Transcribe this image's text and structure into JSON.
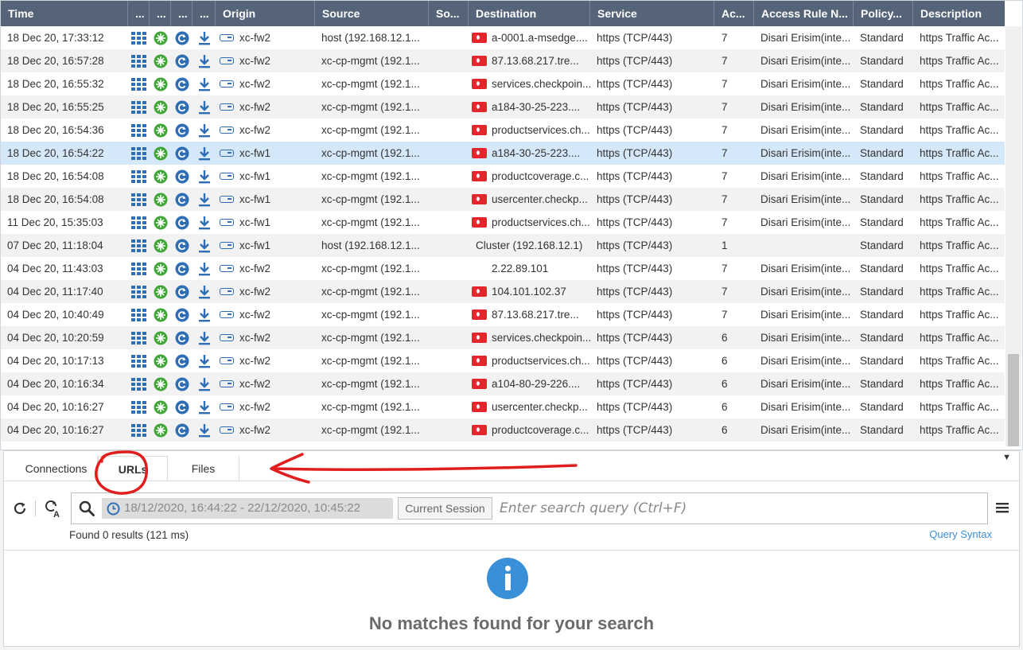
{
  "columns": [
    {
      "key": "time",
      "label": "Time"
    },
    {
      "key": "i1",
      "label": "..."
    },
    {
      "key": "i2",
      "label": "..."
    },
    {
      "key": "i3",
      "label": "..."
    },
    {
      "key": "i4",
      "label": "..."
    },
    {
      "key": "origin",
      "label": "Origin"
    },
    {
      "key": "source",
      "label": "Source"
    },
    {
      "key": "sourceuser",
      "label": "So..."
    },
    {
      "key": "destination",
      "label": "Destination"
    },
    {
      "key": "service",
      "label": "Service"
    },
    {
      "key": "action",
      "label": "Ac..."
    },
    {
      "key": "rule",
      "label": "Access Rule N..."
    },
    {
      "key": "policy",
      "label": "Policy..."
    },
    {
      "key": "description",
      "label": "Description"
    }
  ],
  "rows": [
    {
      "time": "18 Dec 20, 17:33:12",
      "origin": "xc-fw2",
      "source": "host (192.168.12.1...",
      "dest": "a-0001.a-msedge....",
      "flag": true,
      "service": "https (TCP/443)",
      "ac": "7",
      "rule": "Disari Erisim(inte...",
      "policy": "Standard",
      "desc": "https Traffic Ac...",
      "selected": false
    },
    {
      "time": "18 Dec 20, 16:57:28",
      "origin": "xc-fw2",
      "source": "xc-cp-mgmt (192.1...",
      "dest": "87.13.68.217.tre...",
      "flag": true,
      "service": "https (TCP/443)",
      "ac": "7",
      "rule": "Disari Erisim(inte...",
      "policy": "Standard",
      "desc": "https Traffic Ac...",
      "selected": false
    },
    {
      "time": "18 Dec 20, 16:55:32",
      "origin": "xc-fw2",
      "source": "xc-cp-mgmt (192.1...",
      "dest": "services.checkpoin...",
      "flag": true,
      "service": "https (TCP/443)",
      "ac": "7",
      "rule": "Disari Erisim(inte...",
      "policy": "Standard",
      "desc": "https Traffic Ac...",
      "selected": false
    },
    {
      "time": "18 Dec 20, 16:55:25",
      "origin": "xc-fw2",
      "source": "xc-cp-mgmt (192.1...",
      "dest": "a184-30-25-223....",
      "flag": true,
      "service": "https (TCP/443)",
      "ac": "7",
      "rule": "Disari Erisim(inte...",
      "policy": "Standard",
      "desc": "https Traffic Ac...",
      "selected": false
    },
    {
      "time": "18 Dec 20, 16:54:36",
      "origin": "xc-fw2",
      "source": "xc-cp-mgmt (192.1...",
      "dest": "productservices.ch...",
      "flag": true,
      "service": "https (TCP/443)",
      "ac": "7",
      "rule": "Disari Erisim(inte...",
      "policy": "Standard",
      "desc": "https Traffic Ac...",
      "selected": false
    },
    {
      "time": "18 Dec 20, 16:54:22",
      "origin": "xc-fw1",
      "source": "xc-cp-mgmt (192.1...",
      "dest": "a184-30-25-223....",
      "flag": true,
      "service": "https (TCP/443)",
      "ac": "7",
      "rule": "Disari Erisim(inte...",
      "policy": "Standard",
      "desc": "https Traffic Ac...",
      "selected": true
    },
    {
      "time": "18 Dec 20, 16:54:08",
      "origin": "xc-fw1",
      "source": "xc-cp-mgmt (192.1...",
      "dest": "productcoverage.c...",
      "flag": true,
      "service": "https (TCP/443)",
      "ac": "7",
      "rule": "Disari Erisim(inte...",
      "policy": "Standard",
      "desc": "https Traffic Ac...",
      "selected": false
    },
    {
      "time": "18 Dec 20, 16:54:08",
      "origin": "xc-fw1",
      "source": "xc-cp-mgmt (192.1...",
      "dest": "usercenter.checkp...",
      "flag": true,
      "service": "https (TCP/443)",
      "ac": "7",
      "rule": "Disari Erisim(inte...",
      "policy": "Standard",
      "desc": "https Traffic Ac...",
      "selected": false
    },
    {
      "time": "11 Dec 20, 15:35:03",
      "origin": "xc-fw1",
      "source": "xc-cp-mgmt (192.1...",
      "dest": "productservices.ch...",
      "flag": true,
      "service": "https (TCP/443)",
      "ac": "7",
      "rule": "Disari Erisim(inte...",
      "policy": "Standard",
      "desc": "https Traffic Ac...",
      "selected": false
    },
    {
      "time": "07 Dec 20, 11:18:04",
      "origin": "xc-fw1",
      "source": "host (192.168.12.1...",
      "dest": "Cluster (192.168.12.1)",
      "flag": false,
      "noindent": true,
      "service": "https (TCP/443)",
      "ac": "1",
      "rule": "",
      "policy": "Standard",
      "desc": "https Traffic Ac...",
      "selected": false
    },
    {
      "time": "04 Dec 20, 11:43:03",
      "origin": "xc-fw2",
      "source": "xc-cp-mgmt (192.1...",
      "dest": "2.22.89.101",
      "flag": false,
      "service": "https (TCP/443)",
      "ac": "7",
      "rule": "Disari Erisim(inte...",
      "policy": "Standard",
      "desc": "https Traffic Ac...",
      "selected": false
    },
    {
      "time": "04 Dec 20, 11:17:40",
      "origin": "xc-fw2",
      "source": "xc-cp-mgmt (192.1...",
      "dest": "104.101.102.37",
      "flag": true,
      "service": "https (TCP/443)",
      "ac": "7",
      "rule": "Disari Erisim(inte...",
      "policy": "Standard",
      "desc": "https Traffic Ac...",
      "selected": false
    },
    {
      "time": "04 Dec 20, 10:40:49",
      "origin": "xc-fw2",
      "source": "xc-cp-mgmt (192.1...",
      "dest": "87.13.68.217.tre...",
      "flag": true,
      "service": "https (TCP/443)",
      "ac": "7",
      "rule": "Disari Erisim(inte...",
      "policy": "Standard",
      "desc": "https Traffic Ac...",
      "selected": false
    },
    {
      "time": "04 Dec 20, 10:20:59",
      "origin": "xc-fw2",
      "source": "xc-cp-mgmt (192.1...",
      "dest": "services.checkpoin...",
      "flag": true,
      "service": "https (TCP/443)",
      "ac": "6",
      "rule": "Disari Erisim(inte...",
      "policy": "Standard",
      "desc": "https Traffic Ac...",
      "selected": false
    },
    {
      "time": "04 Dec 20, 10:17:13",
      "origin": "xc-fw2",
      "source": "xc-cp-mgmt (192.1...",
      "dest": "productservices.ch...",
      "flag": true,
      "service": "https (TCP/443)",
      "ac": "6",
      "rule": "Disari Erisim(inte...",
      "policy": "Standard",
      "desc": "https Traffic Ac...",
      "selected": false
    },
    {
      "time": "04 Dec 20, 10:16:34",
      "origin": "xc-fw2",
      "source": "xc-cp-mgmt (192.1...",
      "dest": "a104-80-29-226....",
      "flag": true,
      "service": "https (TCP/443)",
      "ac": "6",
      "rule": "Disari Erisim(inte...",
      "policy": "Standard",
      "desc": "https Traffic Ac...",
      "selected": false
    },
    {
      "time": "04 Dec 20, 10:16:27",
      "origin": "xc-fw2",
      "source": "xc-cp-mgmt (192.1...",
      "dest": "usercenter.checkp...",
      "flag": true,
      "service": "https (TCP/443)",
      "ac": "6",
      "rule": "Disari Erisim(inte...",
      "policy": "Standard",
      "desc": "https Traffic Ac...",
      "selected": false
    },
    {
      "time": "04 Dec 20, 10:16:27",
      "origin": "xc-fw2",
      "source": "xc-cp-mgmt (192.1...",
      "dest": "productcoverage.c...",
      "flag": true,
      "service": "https (TCP/443)",
      "ac": "6",
      "rule": "Disari Erisim(inte...",
      "policy": "Standard",
      "desc": "https Traffic Ac...",
      "selected": false
    }
  ],
  "row_icons": [
    "grid-icon",
    "globe-icon",
    "refresh-circle-icon",
    "download-icon"
  ],
  "origin_icon": "gateway-icon",
  "colors": {
    "header_bg": "#56647a",
    "selected_row": "#d5e8f9",
    "flag_red": "#e2262b",
    "accent_blue": "#3a8fd9",
    "icon_green": "#3fa535",
    "icon_blue": "#2f6db5",
    "annotation_red": "#e01e1e"
  },
  "tabs": [
    {
      "label": "Connections",
      "active": false
    },
    {
      "label": "URLs",
      "active": true
    },
    {
      "label": "Files",
      "active": false
    }
  ],
  "toolbar": {
    "refresh_icon": "refresh-icon",
    "clear_icon": "clear-search-icon",
    "search_icon": "search-icon",
    "clock_icon": "clock-icon",
    "time_range": "18/12/2020, 16:44:22 - 22/12/2020, 10:45:22",
    "session_label": "Current Session",
    "query_placeholder": "Enter search query (Ctrl+F)",
    "query_value": "",
    "menu_icon": "hamburger-menu-icon"
  },
  "results": {
    "found_text": "Found 0 results (121 ms)",
    "syntax_link": "Query Syntax",
    "info_icon": "info-icon",
    "empty_message": "No matches found for your search"
  }
}
